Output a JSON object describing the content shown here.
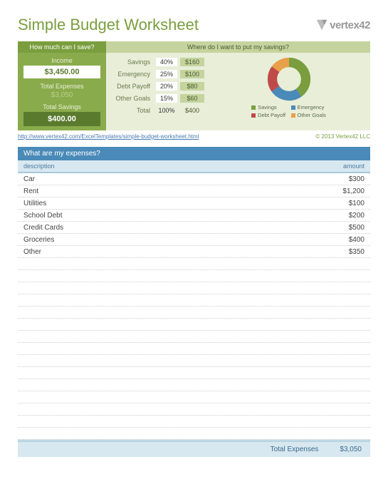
{
  "title": "Simple Budget Worksheet",
  "logo_text": "vertex42",
  "left": {
    "header": "How much can I save?",
    "income_label": "Income",
    "income_value": "$3,450.00",
    "total_expenses_label": "Total Expenses",
    "total_expenses_value": "$3,050",
    "total_savings_label": "Total Savings",
    "total_savings_value": "$400.00"
  },
  "right": {
    "header": "Where do I want to put my savings?",
    "rows": [
      {
        "label": "Savings",
        "pct": "40%",
        "amt": "$160"
      },
      {
        "label": "Emergency",
        "pct": "25%",
        "amt": "$100"
      },
      {
        "label": "Debt Payoff",
        "pct": "20%",
        "amt": "$80"
      },
      {
        "label": "Other Goals",
        "pct": "15%",
        "amt": "$60"
      }
    ],
    "total": {
      "label": "Total",
      "pct": "100%",
      "amt": "$400"
    }
  },
  "chart_data": {
    "type": "pie",
    "title": "",
    "categories": [
      "Savings",
      "Emergency",
      "Debt Payoff",
      "Other Goals"
    ],
    "values": [
      40,
      25,
      20,
      15
    ],
    "colors": [
      "#7a9e3e",
      "#4a8ab8",
      "#c04a4a",
      "#e8a04a"
    ],
    "legend_position": "bottom"
  },
  "footer": {
    "link": "http://www.vertex42.com/ExcelTemplates/simple-budget-worksheet.html",
    "copyright": "© 2013 Vertex42 LLC"
  },
  "expenses": {
    "header": "What are my expenses?",
    "col_desc": "description",
    "col_amt": "amount",
    "rows": [
      {
        "desc": "Car",
        "amt": "$300"
      },
      {
        "desc": "Rent",
        "amt": "$1,200"
      },
      {
        "desc": "Utilities",
        "amt": "$100"
      },
      {
        "desc": "School Debt",
        "amt": "$200"
      },
      {
        "desc": "Credit Cards",
        "amt": "$500"
      },
      {
        "desc": "Groceries",
        "amt": "$400"
      },
      {
        "desc": "Other",
        "amt": "$350"
      }
    ],
    "empty_row_count": 15,
    "total_label": "Total Expenses",
    "total_value": "$3,050"
  }
}
